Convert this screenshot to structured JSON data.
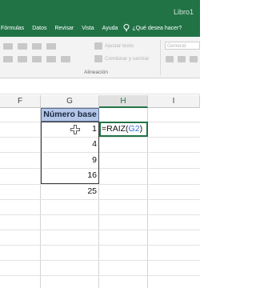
{
  "window": {
    "title": "Libro1"
  },
  "ribbon": {
    "tabs": [
      "Fórmulas",
      "Datos",
      "Revisar",
      "Vista",
      "Ayuda"
    ],
    "tell_me_placeholder": "¿Qué desea hacer?",
    "alignment_group": {
      "label": "Alineación",
      "wrap_text": "Ajustar texto",
      "merge_center": "Combinar y centrar"
    },
    "number_group": {
      "format_value": "General"
    }
  },
  "grid": {
    "columns": [
      "F",
      "G",
      "H",
      "I"
    ],
    "active_column": "H",
    "header_cell": "Número base",
    "values": [
      "1",
      "4",
      "9",
      "16",
      "25"
    ],
    "formula": {
      "prefix": "=RAIZ(",
      "ref": "G2",
      "suffix": ")"
    }
  },
  "colors": {
    "accent": "#217346",
    "header_fill": "#b4c6e7",
    "reference": "#2f6ee0"
  }
}
